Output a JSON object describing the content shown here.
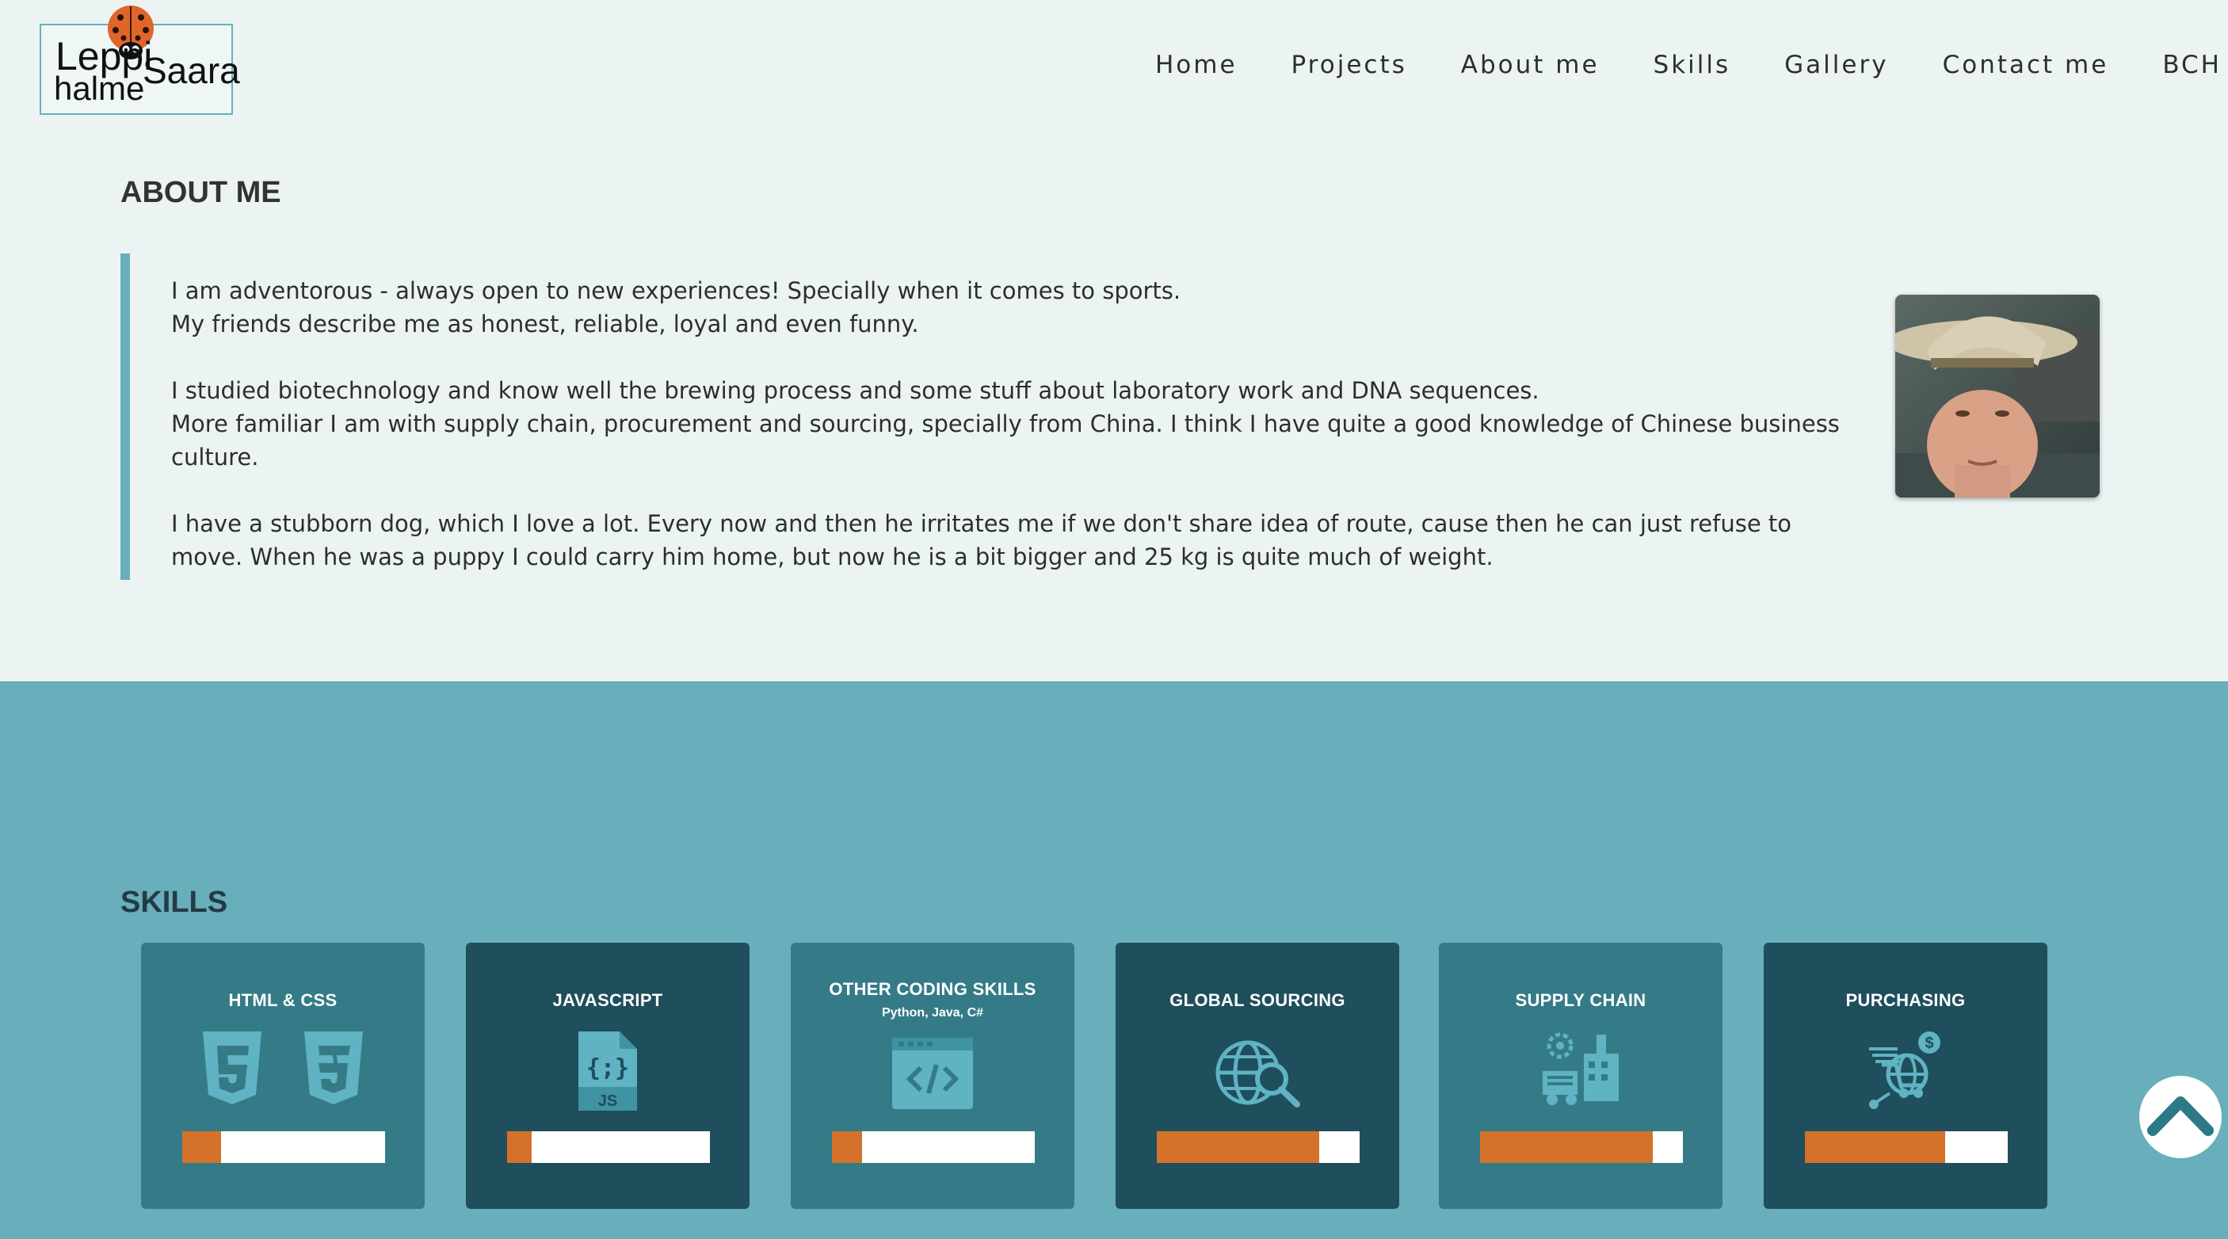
{
  "logo": {
    "line1": "Leppi",
    "line2": "halme",
    "line3": "Saara"
  },
  "nav": [
    "Home",
    "Projects",
    "About me",
    "Skills",
    "Gallery",
    "Contact me",
    "BCH"
  ],
  "about": {
    "title": "ABOUT ME",
    "paragraphs": [
      [
        "I am adventorous - always open to new experiences! Specially when it comes to sports.",
        "My friends describe me as honest, reliable, loyal and even funny."
      ],
      [
        "I studied biotechnology and know well the brewing process and some stuff about laboratory work and DNA sequences.",
        "More familiar I am with supply chain, procurement and sourcing, specially from China. I think I have quite a good knowledge of Chinese business culture."
      ],
      [
        "I have a stubborn dog, which I love a lot. Every now and then he irritates me if we don't share idea of route, cause then he can just refuse to move. When he was a puppy I could carry him home, but now he is a bit bigger and 25 kg is quite much of weight."
      ]
    ]
  },
  "skills": {
    "title": "SKILLS",
    "accent_color": "#d4722b",
    "items": [
      {
        "name": "HTML & CSS",
        "subtitle": "",
        "icon": "html5-css3-icon",
        "level": 0.19
      },
      {
        "name": "JAVASCRIPT",
        "subtitle": "",
        "icon": "js-file-icon",
        "level": 0.12
      },
      {
        "name": "OTHER CODING SKILLS",
        "subtitle": "Python, Java, C#",
        "icon": "code-window-icon",
        "level": 0.15
      },
      {
        "name": "GLOBAL SOURCING",
        "subtitle": "",
        "icon": "globe-search-icon",
        "level": 0.8
      },
      {
        "name": "SUPPLY CHAIN",
        "subtitle": "",
        "icon": "factory-truck-icon",
        "level": 0.85
      },
      {
        "name": "PURCHASING",
        "subtitle": "",
        "icon": "global-purchase-icon",
        "level": 0.69
      }
    ]
  }
}
